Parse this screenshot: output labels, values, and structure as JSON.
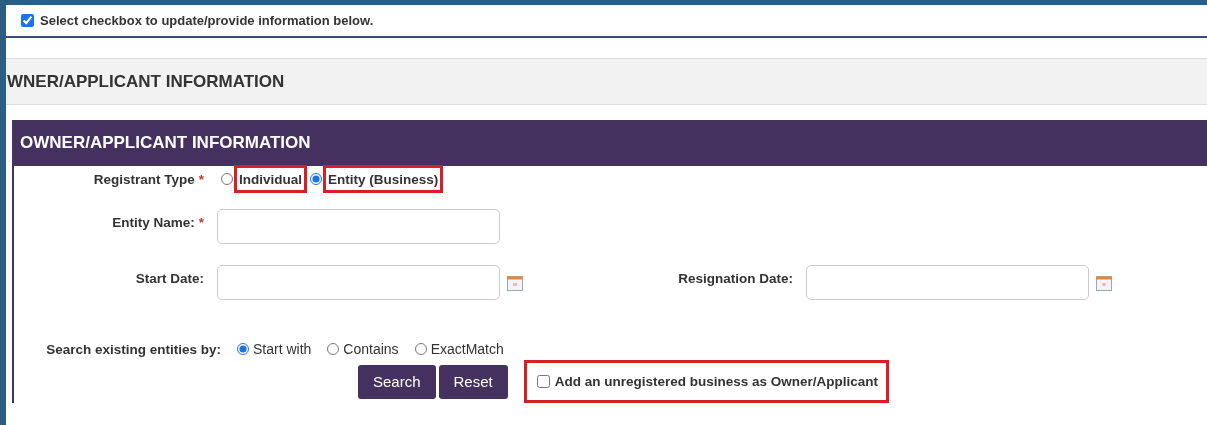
{
  "top_checkbox": {
    "label": "Select checkbox to update/provide information below.",
    "checked": true
  },
  "section_title": "WNER/APPLICANT INFORMATION",
  "panel": {
    "title": "OWNER/APPLICANT INFORMATION",
    "registrant_type": {
      "label": "Registrant Type",
      "required_mark": "*",
      "options": [
        {
          "label": "Individual",
          "selected": false,
          "highlighted": true
        },
        {
          "label": "Entity (Business)",
          "selected": true,
          "highlighted": true
        }
      ]
    },
    "entity_name": {
      "label": "Entity Name:",
      "required_mark": "*"
    },
    "start_date": {
      "label": "Start Date:"
    },
    "resignation_date": {
      "label": "Resignation Date:"
    },
    "search_by": {
      "label": "Search existing entities by:",
      "options": [
        {
          "label": "Start with",
          "selected": true
        },
        {
          "label": "Contains",
          "selected": false
        },
        {
          "label": "ExactMatch",
          "selected": false
        }
      ]
    },
    "buttons": [
      "Search",
      "Reset"
    ],
    "unregistered": {
      "label": "Add an unregistered business as Owner/Applicant",
      "checked": false,
      "highlighted": true
    }
  }
}
